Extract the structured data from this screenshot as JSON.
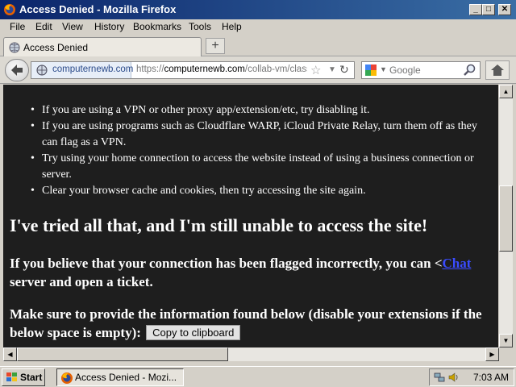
{
  "window": {
    "title": "Access Denied - Mozilla Firefox",
    "buttons": {
      "minimize": "_",
      "maximize": "□",
      "close": "✕"
    }
  },
  "menu": [
    "File",
    "Edit",
    "View",
    "History",
    "Bookmarks",
    "Tools",
    "Help"
  ],
  "tab": {
    "label": "Access Denied",
    "new_tab": "+"
  },
  "nav": {
    "domain": "computernewb.com",
    "url_prefix": "https://",
    "url_host": "computernewb.com",
    "url_path": "/collab-vm/classi",
    "search_placeholder": "Google"
  },
  "content": {
    "bullets": [
      "If you are using a VPN or other proxy app/extension/etc, try disabling it.",
      "If you are using programs such as Cloudflare WARP, iCloud Private Relay, turn them off as they can flag as a VPN.",
      "Try using your home connection to access the website instead of using a business connection or server.",
      "Clear your browser cache and cookies, then try accessing the site again."
    ],
    "heading": "I've tried all that, and I'm still unable to access the site!",
    "flagged_text": "If you believe that your connection has been flagged incorrectly, you can",
    "link_prefix": "<",
    "chat_link": "Chat",
    "flagged_suffix": " server and open a ticket.",
    "info_text": "Make sure to provide the information found below (disable your extensions if the below space is empty):",
    "copy_button": "Copy to clipboard"
  },
  "taskbar": {
    "start": "Start",
    "task": "Access Denied - Mozi...",
    "clock": "7:03 AM"
  },
  "icons": {
    "app": "firefox-icon",
    "back": "back-arrow-icon",
    "identity": "globe-icon",
    "bookmark": "star-icon",
    "reload": "reload-icon",
    "search_engine": "google-icon",
    "search": "magnifier-icon",
    "home": "home-icon"
  },
  "colors": {
    "titlebar_start": "#0a246a",
    "titlebar_end": "#3a6ea5",
    "page_bg": "#1e1e1e",
    "link": "#3a4cff"
  }
}
